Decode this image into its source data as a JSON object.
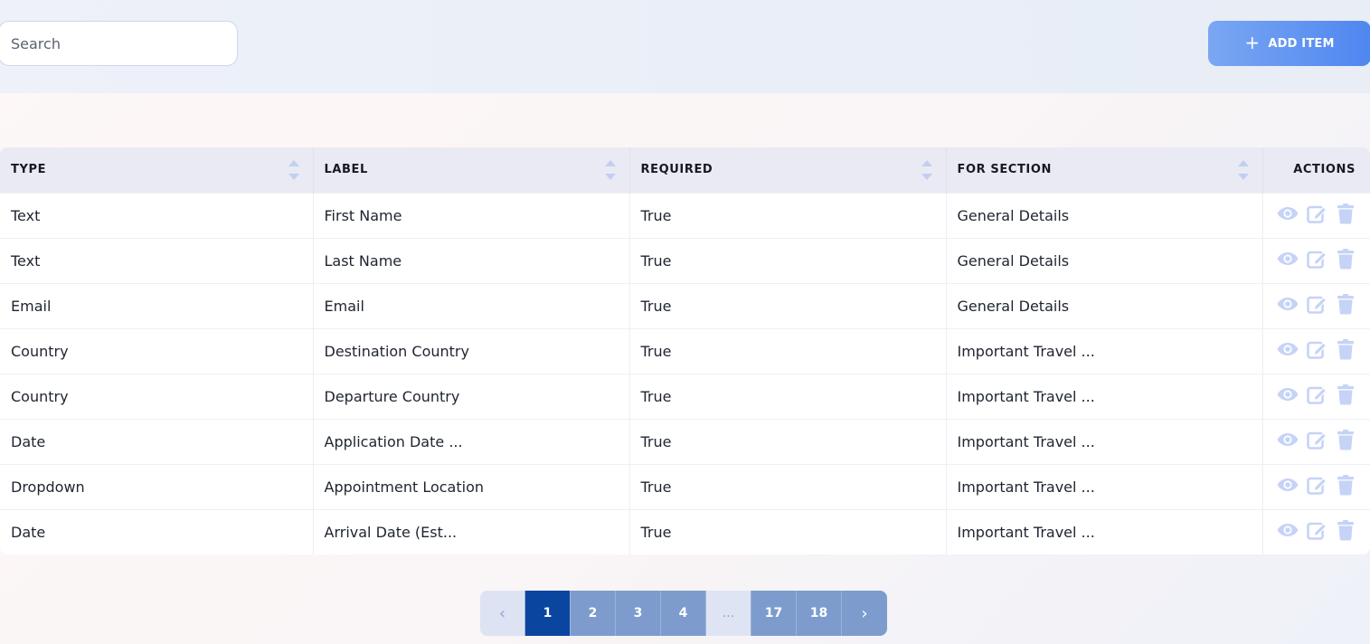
{
  "search": {
    "placeholder": "Search",
    "value": ""
  },
  "toolbar": {
    "add_label": "ADD ITEM"
  },
  "colors": {
    "icon": "#c5d3f7",
    "accent": "#4f86f0",
    "active_page": "#0a45a0"
  },
  "table": {
    "columns": [
      "TYPE",
      "LABEL",
      "REQUIRED",
      "FOR SECTION",
      "ACTIONS"
    ],
    "rows": [
      {
        "type": "Text",
        "label": "First Name",
        "required": "True",
        "section": "General Details"
      },
      {
        "type": "Text",
        "label": "Last Name",
        "required": "True",
        "section": "General Details"
      },
      {
        "type": "Email",
        "label": "Email",
        "required": "True",
        "section": "General Details"
      },
      {
        "type": "Country",
        "label": "Destination Country",
        "required": "True",
        "section": "Important Travel ..."
      },
      {
        "type": "Country",
        "label": "Departure Country",
        "required": "True",
        "section": "Important Travel ..."
      },
      {
        "type": "Date",
        "label": "Application Date ...",
        "required": "True",
        "section": "Important Travel ..."
      },
      {
        "type": "Dropdown",
        "label": "Appointment Location",
        "required": "True",
        "section": "Important Travel ..."
      },
      {
        "type": "Date",
        "label": "Arrival Date (Est...",
        "required": "True",
        "section": "Important Travel ..."
      }
    ],
    "action_icons": [
      "eye-icon",
      "edit-icon",
      "trash-icon"
    ]
  },
  "pagination": {
    "prev": "‹",
    "pages": [
      "1",
      "2",
      "3",
      "4",
      "...",
      "17",
      "18"
    ],
    "current": "1",
    "next": "›"
  }
}
